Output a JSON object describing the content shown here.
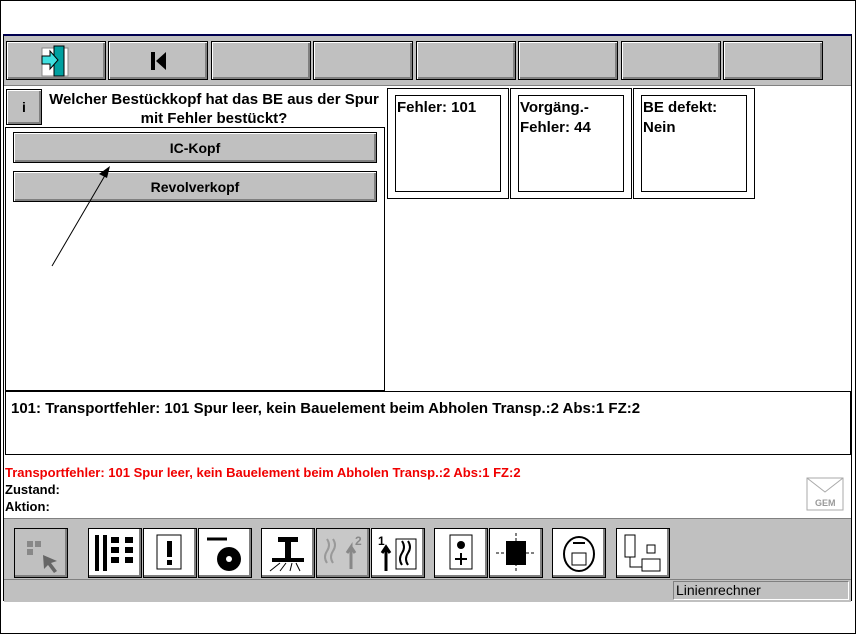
{
  "toolbar": {
    "buttons": [
      {
        "icon": "exit-door-icon"
      },
      {
        "icon": "skip-to-start-icon"
      },
      {},
      {},
      {},
      {},
      {},
      {}
    ]
  },
  "question": {
    "info_label": "i",
    "text": "Welcher Bestückkopf hat das BE aus der Spur mit Fehler bestückt?"
  },
  "answers": [
    "IC-Kopf",
    "Revolverkopf"
  ],
  "info_boxes": [
    "Fehler: 101",
    "Vorgäng.-\nFehler: 44",
    "BE defekt:\nNein"
  ],
  "message": "101: Transportfehler: 101  Spur leer, kein Bauelement beim Abholen  Transp.:2  Abs:1  FZ:2",
  "status": {
    "error": "Transportfehler: 101  Spur leer, kein Bauelement beim Abholen  Transp.:2  Abs:1  FZ:2",
    "zustand": "Zustand:",
    "aktion": "Aktion:",
    "gem_label": "GEM"
  },
  "statusbar": {
    "field": "Linienrechner"
  },
  "colors": {
    "error": "#f00000",
    "toolbar": "#c0c0c0",
    "title_line": "#000050"
  }
}
